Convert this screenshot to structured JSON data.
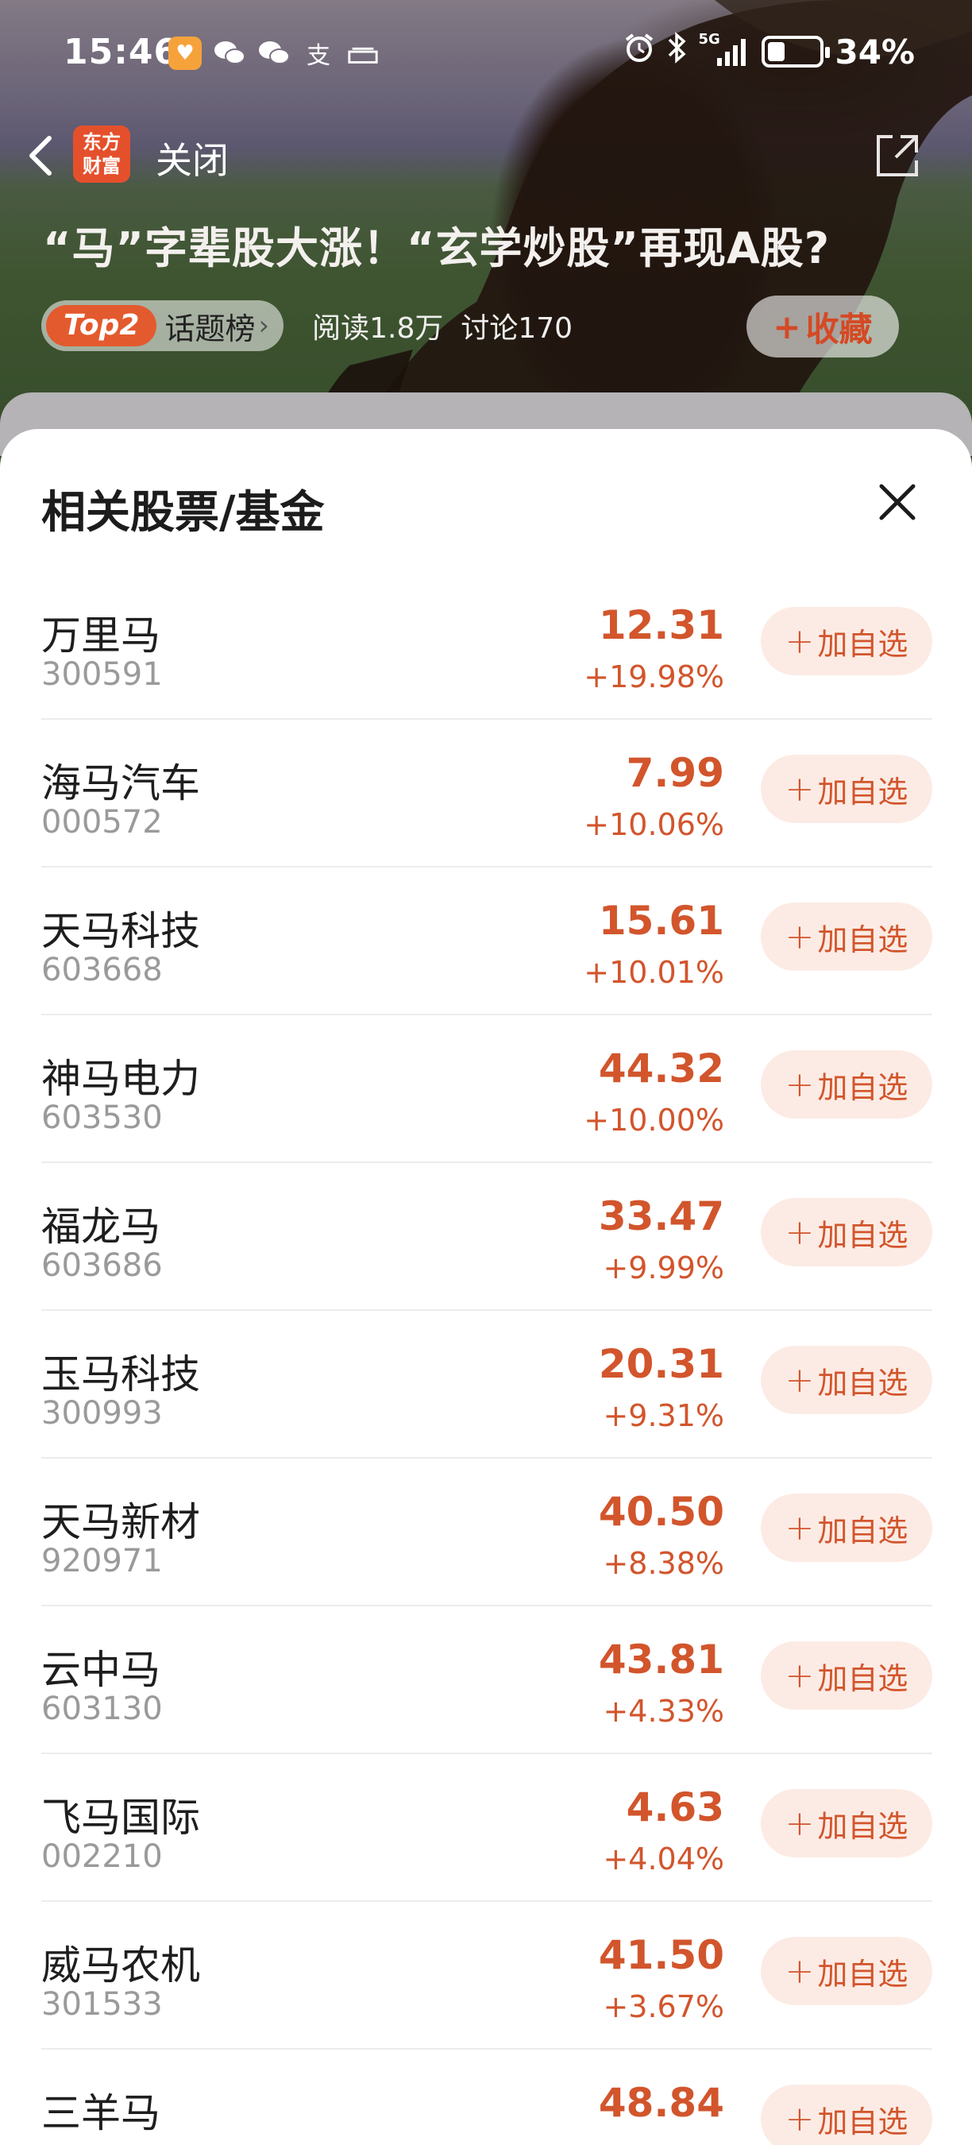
{
  "status_bar": {
    "time": "15:46",
    "network": "5G",
    "battery": "34%",
    "battery_level": 0.34,
    "left_icons": [
      "app-notification-icon",
      "wechat-icon",
      "wechat-icon",
      "alipay-icon",
      "news-app-icon"
    ],
    "right_icons": [
      "alarm-icon",
      "bluetooth-icon",
      "signal-icon",
      "battery-icon"
    ]
  },
  "nav": {
    "app_logo_line1": "东方",
    "app_logo_line2": "财富",
    "close_label": "关闭"
  },
  "topic": {
    "title": "“马”字辈股大涨！“玄学炒股”再现A股?",
    "rank_tag": "Top2",
    "rank_label": "话题榜",
    "reads": "阅读1.8万",
    "discussions": "讨论170",
    "favorite_label": "收藏"
  },
  "sheet": {
    "title": "相关股票/基金",
    "add_label": "加自选",
    "stocks": [
      {
        "name": "万里马",
        "code": "300591",
        "price": "12.31",
        "change": "+19.98%"
      },
      {
        "name": "海马汽车",
        "code": "000572",
        "price": "7.99",
        "change": "+10.06%"
      },
      {
        "name": "天马科技",
        "code": "603668",
        "price": "15.61",
        "change": "+10.01%"
      },
      {
        "name": "神马电力",
        "code": "603530",
        "price": "44.32",
        "change": "+10.00%"
      },
      {
        "name": "福龙马",
        "code": "603686",
        "price": "33.47",
        "change": "+9.99%"
      },
      {
        "name": "玉马科技",
        "code": "300993",
        "price": "20.31",
        "change": "+9.31%"
      },
      {
        "name": "天马新材",
        "code": "920971",
        "price": "40.50",
        "change": "+8.38%"
      },
      {
        "name": "云中马",
        "code": "603130",
        "price": "43.81",
        "change": "+4.33%"
      },
      {
        "name": "飞马国际",
        "code": "002210",
        "price": "4.63",
        "change": "+4.04%"
      },
      {
        "name": "威马农机",
        "code": "301533",
        "price": "41.50",
        "change": "+3.67%"
      },
      {
        "name": "三羊马",
        "code": "",
        "price": "48.84",
        "change": ""
      }
    ]
  },
  "colors": {
    "up": "#d2552c",
    "add_bg": "#fcebe4",
    "brand": "#e5502c"
  }
}
